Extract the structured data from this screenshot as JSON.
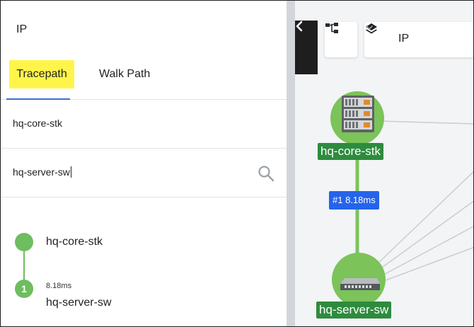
{
  "panel": {
    "title": "IP",
    "tabs": [
      {
        "label": "Tracepath",
        "active": true
      },
      {
        "label": "Walk Path",
        "active": false
      }
    ],
    "source_value": "hq-core-stk",
    "destination_value": "hq-server-sw",
    "path": [
      {
        "name": "hq-core-stk"
      },
      {
        "step": "1",
        "latency": "8.18ms",
        "name": "hq-server-sw"
      }
    ]
  },
  "map": {
    "layer_select": {
      "value": "IP"
    },
    "devices": [
      {
        "name": "hq-core-stk",
        "icon": "switch-stack-icon"
      },
      {
        "name": "hq-server-sw",
        "icon": "switch-icon"
      }
    ],
    "link_label": "#1 8.18ms"
  },
  "colors": {
    "highlight": "#fff54a",
    "tab_underline": "#3a6fd8",
    "path_green": "#6ebd5e",
    "device_label_bg": "#2e8b3e",
    "link_label_bg": "#2563eb",
    "collapse_bg": "#1e1e1e"
  }
}
